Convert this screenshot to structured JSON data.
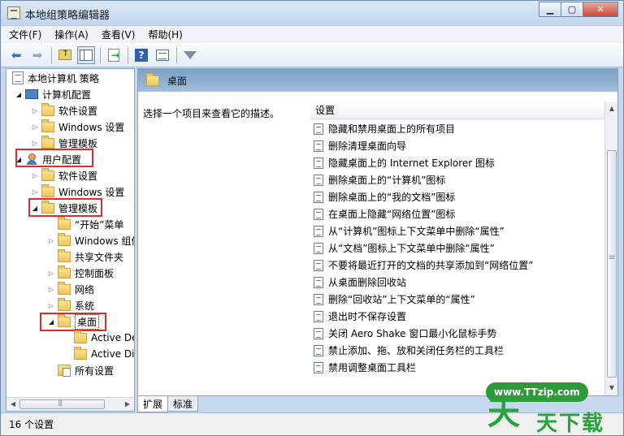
{
  "window": {
    "title": "本地组策略编辑器",
    "minimize": "▁",
    "maximize": "▢",
    "close": "✕"
  },
  "menu": [
    "文件(F)",
    "操作(A)",
    "查看(V)",
    "帮助(H)"
  ],
  "tree": {
    "root": "本地计算机 策略",
    "computer_config": "计算机配置",
    "cc_software": "软件设置",
    "cc_windows": "Windows 设置",
    "cc_admin": "管理模板",
    "user_config": "用户配置",
    "uc_software": "软件设置",
    "uc_windows": "Windows 设置",
    "uc_admin": "管理模板",
    "start_menu": "“开始”菜单",
    "windows_comp": "Windows 组件",
    "shared_folders": "共享文件夹",
    "control_panel": "控制面板",
    "network": "网络",
    "system": "系统",
    "desktop": "桌面",
    "active_desktop": "Active Desktop",
    "active_dir": "Active Directory",
    "all_settings": "所有设置"
  },
  "right": {
    "header_title": "桌面",
    "description": "选择一个项目来查看它的描述。",
    "column_header": "设置",
    "settings": [
      "隐藏和禁用桌面上的所有项目",
      "删除清理桌面向导",
      "隐藏桌面上的 Internet Explorer 图标",
      "删除桌面上的“计算机”图标",
      "删除桌面上的“我的文档”图标",
      "在桌面上隐藏“网络位置”图标",
      "从“计算机”图标上下文菜单中删除“属性”",
      "从“文档”图标上下文菜单中删除“属性”",
      "不要将最近打开的文档的共享添加到“网络位置”",
      "从桌面删除回收站",
      "删除“回收站”上下文菜单的“属性”",
      "退出时不保存设置",
      "关闭 Aero Shake 窗口最小化鼠标手势",
      "禁止添加、拖、放和关闭任务栏的工具栏",
      "禁用调整桌面工具栏"
    ]
  },
  "tabs": [
    "扩展",
    "标准"
  ],
  "status": "16 个设置",
  "watermark": {
    "url": "www.TTzip.com",
    "big": "天",
    "small": "天下载"
  }
}
